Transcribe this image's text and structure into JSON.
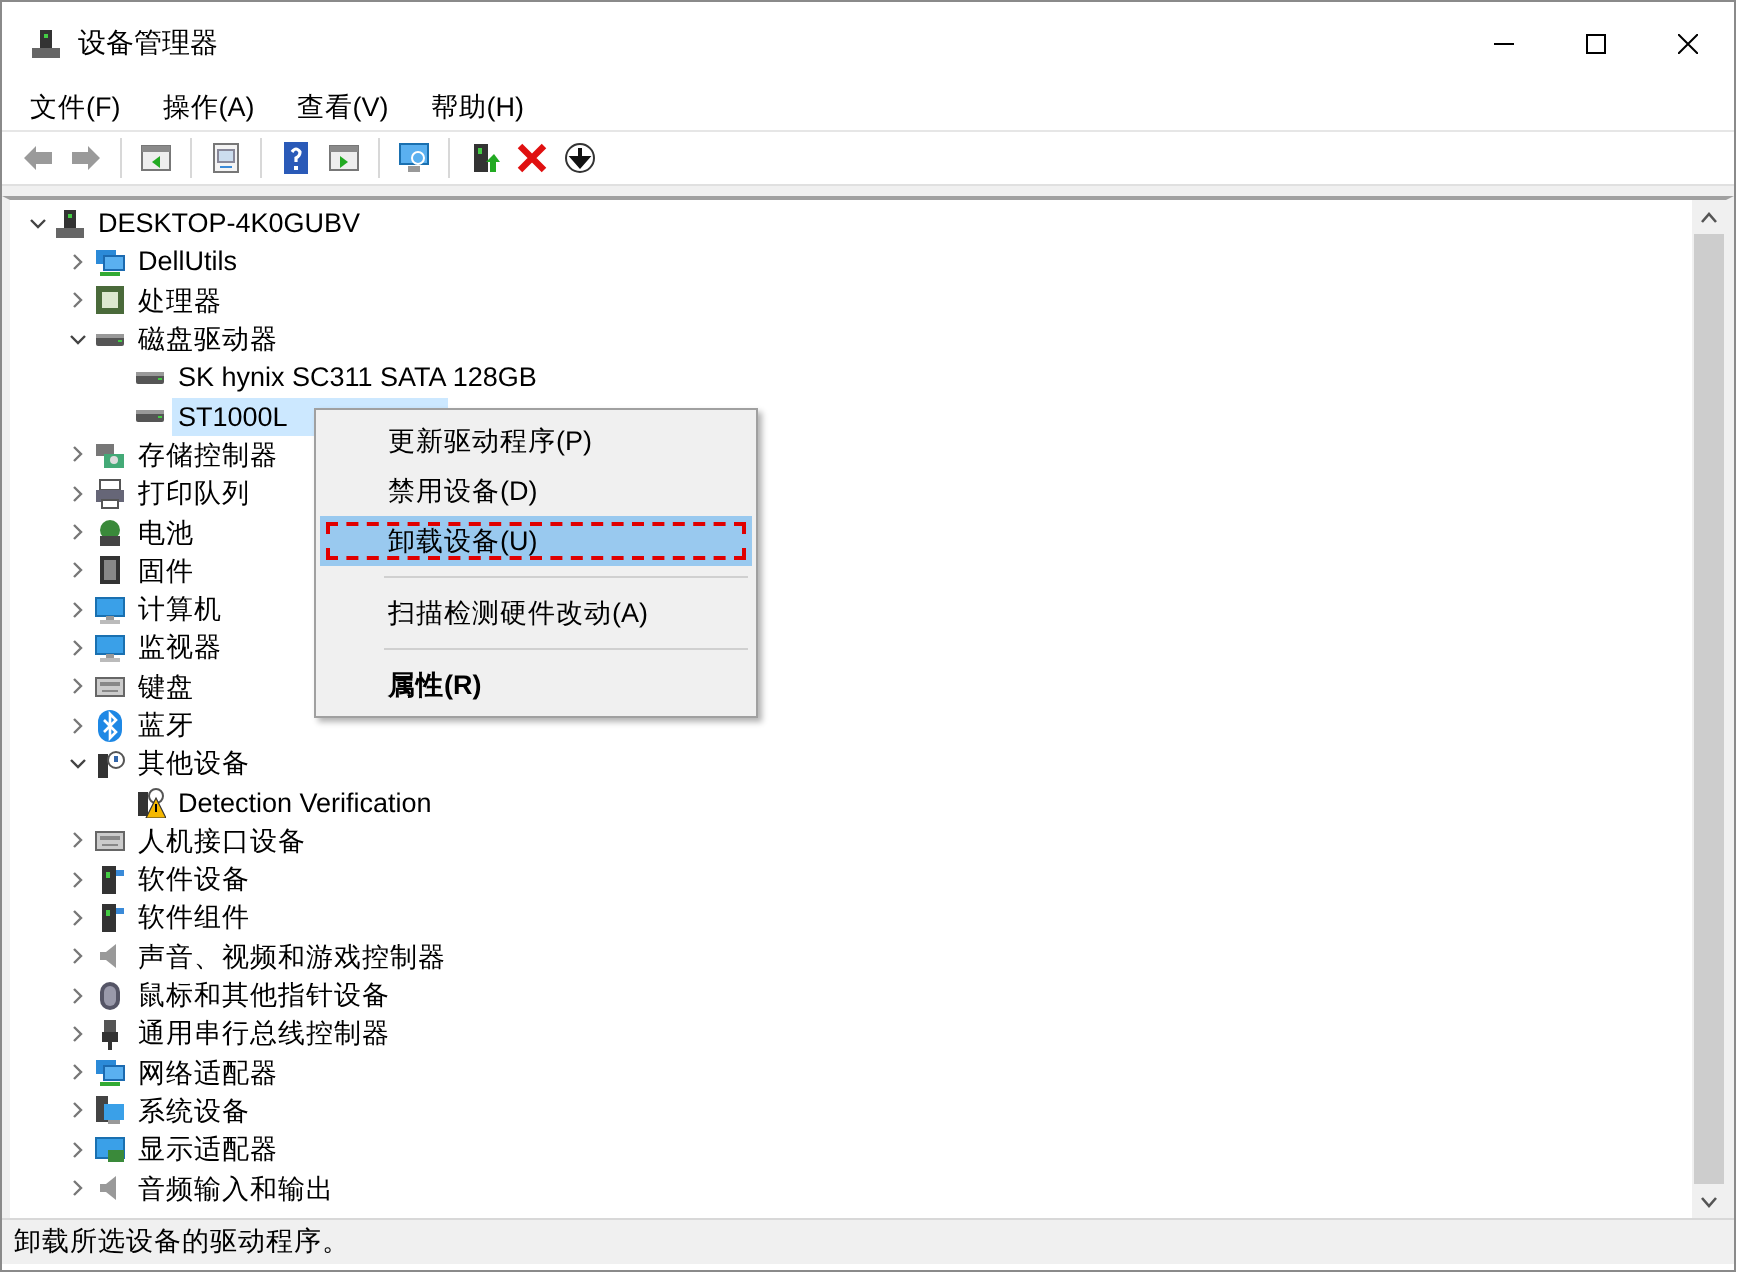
{
  "window": {
    "title": "设备管理器",
    "controls": [
      {
        "kind": "minimize"
      },
      {
        "kind": "maximize"
      },
      {
        "kind": "close"
      }
    ]
  },
  "menu_bar": [
    "文件(F)",
    "操作(A)",
    "查看(V)",
    "帮助(H)"
  ],
  "toolbar": [
    {
      "kind": "back",
      "disabled": true
    },
    {
      "kind": "forward",
      "disabled": true
    },
    {
      "kind": "sep"
    },
    {
      "kind": "pane"
    },
    {
      "kind": "sep"
    },
    {
      "kind": "properties"
    },
    {
      "kind": "sep"
    },
    {
      "kind": "help"
    },
    {
      "kind": "pane2"
    },
    {
      "kind": "sep"
    },
    {
      "kind": "scan"
    },
    {
      "kind": "sep"
    },
    {
      "kind": "update"
    },
    {
      "kind": "remove"
    },
    {
      "kind": "download"
    }
  ],
  "tree": [
    {
      "label": "DESKTOP-4K0GUBV",
      "kind": "computer",
      "expanded": true,
      "selected": false,
      "children": [
        {
          "label": "DellUtils",
          "kind": "network",
          "expanded": false,
          "selected": false
        },
        {
          "label": "处理器",
          "kind": "cpu",
          "expanded": false,
          "selected": false
        },
        {
          "label": "磁盘驱动器",
          "kind": "disk",
          "expanded": true,
          "selected": false,
          "children": [
            {
              "label": "SK hynix SC311 SATA 128GB",
              "kind": "disk",
              "selected": false
            },
            {
              "label": "ST1000L",
              "kind": "disk",
              "selected": true
            }
          ]
        },
        {
          "label": "存储控制器",
          "kind": "storage",
          "expanded": false,
          "selected": false
        },
        {
          "label": "打印队列",
          "kind": "printer",
          "expanded": false,
          "selected": false
        },
        {
          "label": "电池",
          "kind": "battery",
          "expanded": false,
          "selected": false
        },
        {
          "label": "固件",
          "kind": "chip",
          "expanded": false,
          "selected": false
        },
        {
          "label": "计算机",
          "kind": "monitor",
          "expanded": false,
          "selected": false
        },
        {
          "label": "监视器",
          "kind": "monitor",
          "expanded": false,
          "selected": false
        },
        {
          "label": "键盘",
          "kind": "keyboard",
          "expanded": false,
          "selected": false
        },
        {
          "label": "蓝牙",
          "kind": "bluetooth",
          "expanded": false,
          "selected": false
        },
        {
          "label": "其他设备",
          "kind": "unknown",
          "expanded": true,
          "selected": false,
          "children": [
            {
              "label": "Detection Verification",
              "kind": "warning",
              "selected": false
            }
          ]
        },
        {
          "label": "人机接口设备",
          "kind": "keyboard",
          "expanded": false,
          "selected": false
        },
        {
          "label": "软件设备",
          "kind": "tower",
          "expanded": false,
          "selected": false
        },
        {
          "label": "软件组件",
          "kind": "tower",
          "expanded": false,
          "selected": false
        },
        {
          "label": "声音、视频和游戏控制器",
          "kind": "sound",
          "expanded": false,
          "selected": false
        },
        {
          "label": "鼠标和其他指针设备",
          "kind": "mouse",
          "expanded": false,
          "selected": false
        },
        {
          "label": "通用串行总线控制器",
          "kind": "usb",
          "expanded": false,
          "selected": false
        },
        {
          "label": "网络适配器",
          "kind": "network",
          "expanded": false,
          "selected": false
        },
        {
          "label": "系统设备",
          "kind": "system",
          "expanded": false,
          "selected": false
        },
        {
          "label": "显示适配器",
          "kind": "display",
          "expanded": false,
          "selected": false
        },
        {
          "label": "音频输入和输出",
          "kind": "sound",
          "expanded": false,
          "selected": false
        }
      ]
    }
  ],
  "context_menu": [
    {
      "kind": "item",
      "label": "更新驱动程序(P)",
      "selected": false,
      "default": false
    },
    {
      "kind": "item",
      "label": "禁用设备(D)",
      "selected": false,
      "default": false
    },
    {
      "kind": "item",
      "label": "卸载设备(U)",
      "selected": true,
      "default": false
    },
    {
      "kind": "separator"
    },
    {
      "kind": "item",
      "label": "扫描检测硬件改动(A)",
      "selected": false,
      "default": false
    },
    {
      "kind": "separator"
    },
    {
      "kind": "item",
      "label": "属性(R)",
      "selected": false,
      "default": true
    }
  ],
  "status_bar": "卸载所选设备的驱动程序。"
}
